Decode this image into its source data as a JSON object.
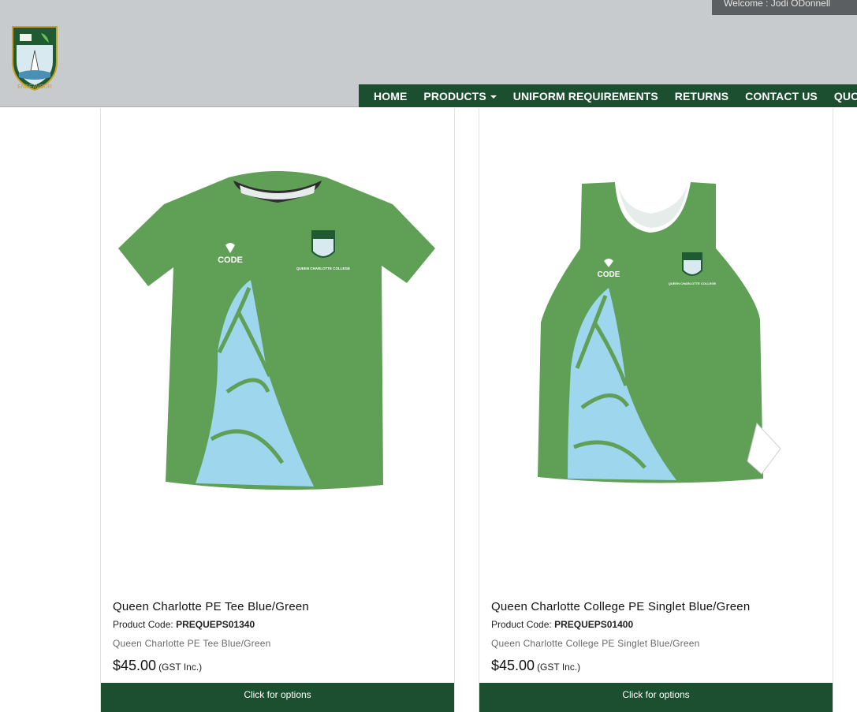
{
  "header": {
    "welcome": "Welcome : Jodi ODonnell",
    "logo_motto": "ENDEAVOUR"
  },
  "nav": {
    "items": [
      "HOME",
      "PRODUCTS",
      "UNIFORM REQUIREMENTS",
      "RETURNS",
      "CONTACT US",
      "QUOTE R"
    ]
  },
  "products": [
    {
      "name": "Queen Charlotte PE Tee Blue/Green",
      "code_label": "Product Code:",
      "code": "PREQUEPS01340",
      "description": "Queen Charlotte PE Tee Blue/Green",
      "price": "$45.00",
      "gst": "(GST Inc.)",
      "button": "Click for options",
      "brand_text": "CODE",
      "crest_text": "QUEEN CHARLOTTE COLLEGE"
    },
    {
      "name": "Queen Charlotte College PE Singlet Blue/Green",
      "code_label": "Product Code:",
      "code": "PREQUEPS01400",
      "description": "Queen Charlotte College PE Singlet Blue/Green",
      "price": "$45.00",
      "gst": "(GST Inc.)",
      "button": "Click for options",
      "brand_text": "CODE",
      "crest_text": "QUEEN CHARLOTTE COLLEGE"
    }
  ],
  "colors": {
    "header_bg": "#c8cbcd",
    "nav_bg": "#1b4f2f",
    "garment_green": "#5f9f56",
    "pattern_blue": "#9ed6ee"
  }
}
